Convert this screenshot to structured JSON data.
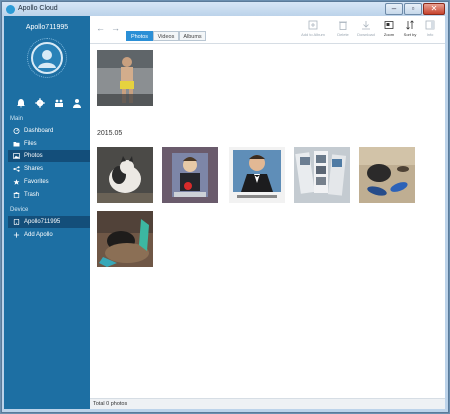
{
  "window": {
    "title": "Apollo Cloud",
    "minimize": "–",
    "maximize": "▫",
    "close": "✕"
  },
  "sidebar": {
    "username": "Apollo711995",
    "sections": {
      "main": "Main",
      "device": "Device"
    },
    "main_items": [
      {
        "label": "Dashboard",
        "icon": "dashboard-icon"
      },
      {
        "label": "Files",
        "icon": "files-icon"
      },
      {
        "label": "Photos",
        "icon": "photos-icon",
        "active": true
      },
      {
        "label": "Shares",
        "icon": "shares-icon"
      },
      {
        "label": "Favorites",
        "icon": "favorites-icon"
      },
      {
        "label": "Trash",
        "icon": "trash-icon"
      }
    ],
    "device_items": [
      {
        "label": "Apollo711995",
        "icon": "device-icon",
        "active": true
      },
      {
        "label": "Add Apollo",
        "icon": "plus-icon"
      }
    ]
  },
  "toolbar": {
    "back": "←",
    "forward": "→",
    "tabs": [
      {
        "label": "Photos",
        "active": true
      },
      {
        "label": "Videos"
      },
      {
        "label": "Albums"
      }
    ],
    "tools": [
      {
        "label": "Add to Album",
        "icon": "add-to-album-icon",
        "enabled": false
      },
      {
        "label": "Delete",
        "icon": "delete-icon",
        "enabled": false
      },
      {
        "label": "Download",
        "icon": "download-icon",
        "enabled": false
      },
      {
        "label": "Zoom",
        "icon": "zoom-icon",
        "enabled": true
      },
      {
        "label": "Sort by",
        "icon": "sort-icon",
        "enabled": true
      },
      {
        "label": "Info",
        "icon": "info-icon",
        "enabled": false
      }
    ]
  },
  "gallery": {
    "group_label": "2015.05"
  },
  "status": {
    "text": "Total 0 photos"
  },
  "colors": {
    "sidebar": "#1d6fa3",
    "accent": "#2b8fd6",
    "active_item": "#134e7a"
  }
}
